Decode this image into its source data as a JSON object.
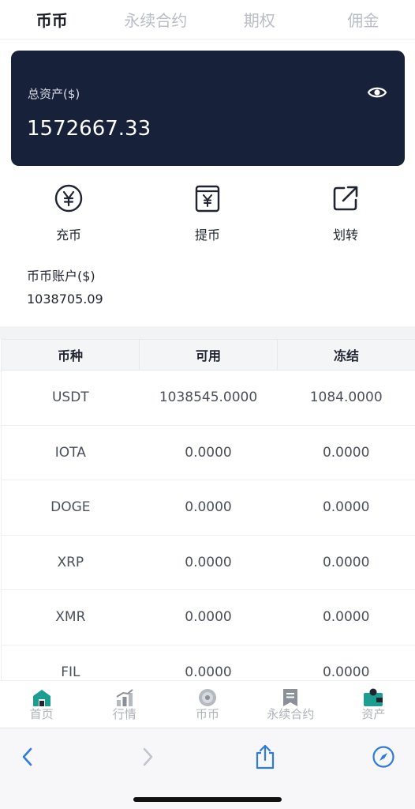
{
  "tabs": [
    {
      "label": "币币",
      "active": true
    },
    {
      "label": "永续合约",
      "active": false
    },
    {
      "label": "期权",
      "active": false
    },
    {
      "label": "佣金",
      "active": false
    }
  ],
  "asset_card": {
    "label": "总资产($)",
    "value": "1572667.33",
    "icon": "eye-icon"
  },
  "actions": [
    {
      "label": "充币",
      "icon": "deposit-yen-circle-icon"
    },
    {
      "label": "提币",
      "icon": "withdraw-yen-box-icon"
    },
    {
      "label": "划转",
      "icon": "transfer-arrow-icon"
    }
  ],
  "account": {
    "label": "币币账户($)",
    "value": "1038705.09"
  },
  "table": {
    "headers": [
      "币种",
      "可用",
      "冻结"
    ],
    "rows": [
      [
        "USDT",
        "1038545.0000",
        "1084.0000"
      ],
      [
        "IOTA",
        "0.0000",
        "0.0000"
      ],
      [
        "DOGE",
        "0.0000",
        "0.0000"
      ],
      [
        "XRP",
        "0.0000",
        "0.0000"
      ],
      [
        "XMR",
        "0.0000",
        "0.0000"
      ],
      [
        "FIL",
        "0.0000",
        "0.0000"
      ]
    ]
  },
  "bottom_nav": [
    {
      "label": "首页",
      "icon": "home-icon",
      "active": true
    },
    {
      "label": "行情",
      "icon": "market-chart-icon",
      "active": false
    },
    {
      "label": "币币",
      "icon": "coin-icon",
      "active": false
    },
    {
      "label": "永续合约",
      "icon": "contract-icon",
      "active": false
    },
    {
      "label": "资产",
      "icon": "wallet-icon",
      "active": true
    }
  ],
  "colors": {
    "accent": "#1b9e8f",
    "card_bg": "#18213a",
    "browser_blue": "#2f7ae0",
    "inactive": "#aeb2ba"
  },
  "browser_bar": [
    "back-icon",
    "forward-icon",
    "share-icon",
    "compass-icon"
  ]
}
